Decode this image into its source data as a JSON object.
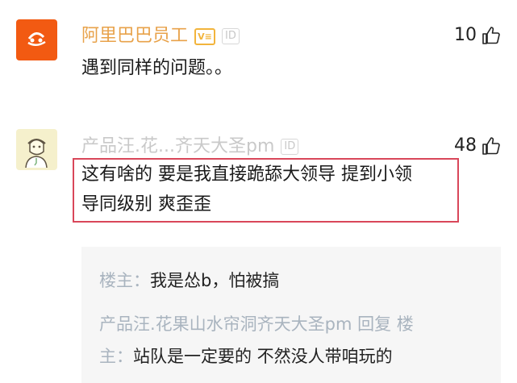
{
  "comments": [
    {
      "username": "阿里巴巴员工",
      "badge": "ID",
      "likes": "10",
      "text": "遇到同样的问题。。",
      "avatar_brand": "Alibaba Group",
      "avatar_brand_cn": "阿里巴巴集团"
    },
    {
      "username": "产品汪.花...齐天大圣pm",
      "badge": "ID",
      "likes": "48",
      "text_line1": "这有啥的 要是我直接跪舔大领导 提到小领",
      "text_line2": "导同级别 爽歪歪"
    }
  ],
  "replies": [
    {
      "author": "楼主：",
      "text": "我是怂b，怕被搞"
    },
    {
      "author_line1": "产品汪.花果山水帘洞齐天大圣pm 回复 楼",
      "author_line2": "主：",
      "text": "站队是一定要的 不然没人带咱玩的"
    }
  ],
  "colors": {
    "alibaba_orange": "#f25a12",
    "username_orange": "#e8a24a",
    "username_gray": "#c9c9c9",
    "highlight_red": "#d9475a",
    "reply_bg": "#f6f6f6"
  }
}
